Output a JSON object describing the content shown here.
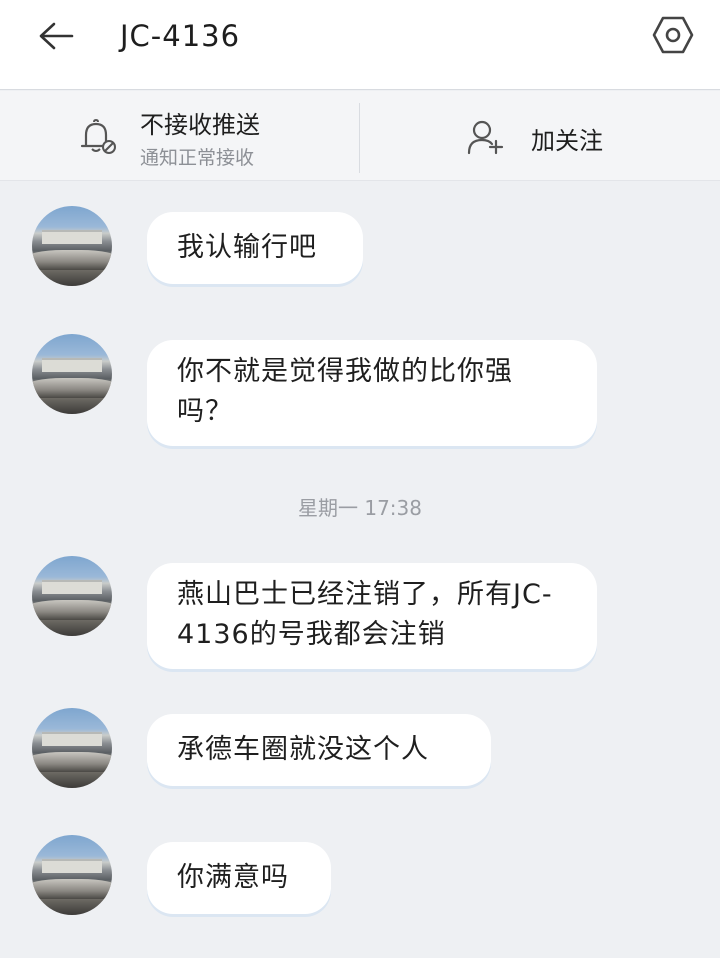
{
  "header": {
    "title": "JC-4136",
    "back_icon": "arrow-left-icon",
    "settings_icon": "hexagon-settings-icon"
  },
  "action_bar": {
    "push_title": "不接收推送",
    "push_subtitle": "通知正常接收",
    "push_icon": "bell-off-icon",
    "follow_label": "加关注",
    "follow_icon": "user-add-icon"
  },
  "messages": [
    {
      "text": "我认输行吧"
    },
    {
      "text": "你不就是觉得我做的比你强吗？"
    },
    {
      "text": "燕山巴士已经注销了，所有JC-4136的号我都会注销"
    },
    {
      "text": "承德车圈就没这个人"
    },
    {
      "text": "你满意吗"
    }
  ],
  "timestamp": "星期一 17:38",
  "colors": {
    "background": "#eef0f3",
    "bubble": "#ffffff",
    "bubble_shadow": "#dbe6f2",
    "secondary_text": "#8d9096"
  }
}
